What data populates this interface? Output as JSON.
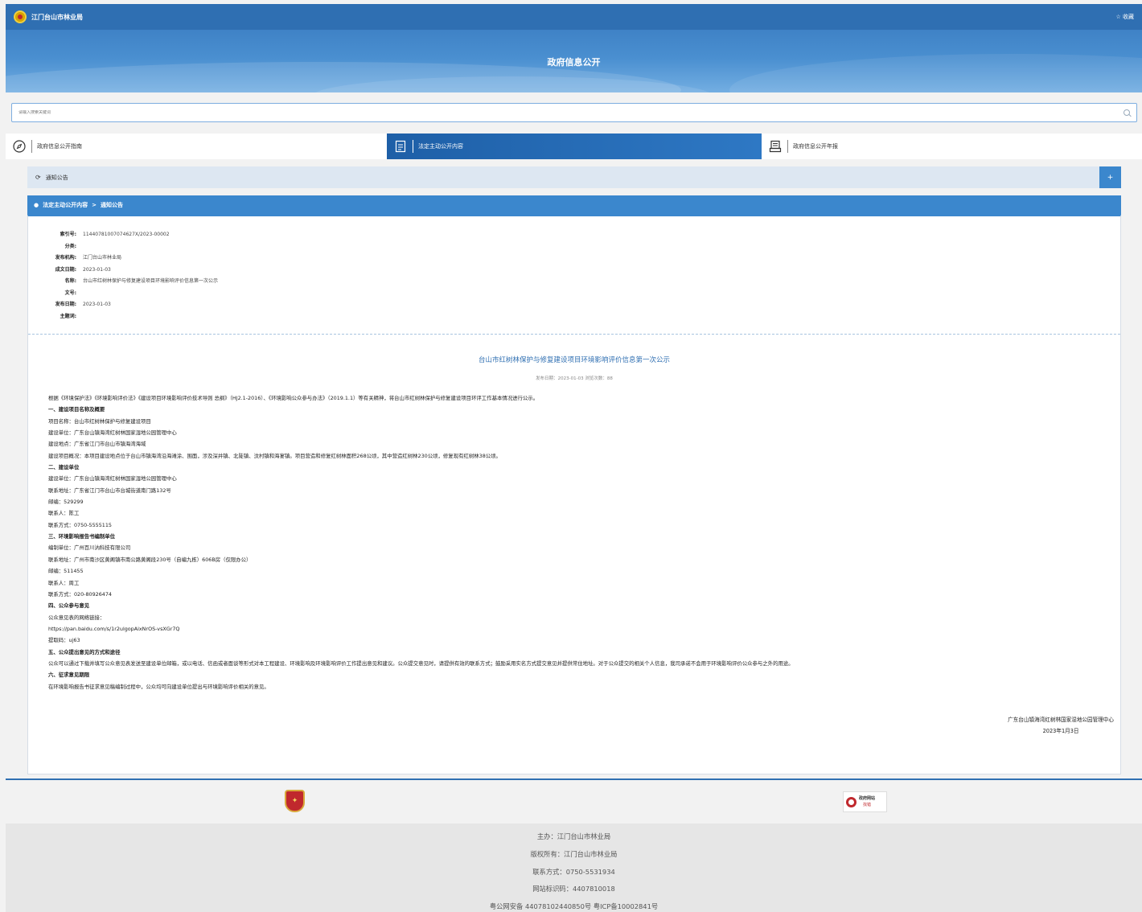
{
  "topbar": {
    "site_name": "江门台山市林业局",
    "favorite": "☆ 收藏"
  },
  "banner": {
    "title": "政府信息公开"
  },
  "search": {
    "placeholder": "请输入搜索关键词"
  },
  "tabs": [
    {
      "label": "政府信息公开指南",
      "icon": "compass-icon"
    },
    {
      "label": "法定主动公开内容",
      "icon": "document-icon",
      "active": true
    },
    {
      "label": "政府信息公开年报",
      "icon": "report-icon"
    }
  ],
  "notice": {
    "label": "通知公告",
    "expand": "+"
  },
  "breadcrumb": {
    "root": "法定主动公开内容",
    "separator": ">",
    "current": "通知公告"
  },
  "meta": [
    {
      "label": "索引号:",
      "value": "11440781007074627X/2023-00002"
    },
    {
      "label": "分类:",
      "value": ""
    },
    {
      "label": "发布机构:",
      "value": "江门台山市林业局"
    },
    {
      "label": "成文日期:",
      "value": "2023-01-03"
    },
    {
      "label": "名称:",
      "value": "台山市红树林保护与修复建设项目环境影响评价信息第一次公示"
    },
    {
      "label": "文号:",
      "value": ""
    },
    {
      "label": "发布日期:",
      "value": "2023-01-03"
    },
    {
      "label": "主题词:",
      "value": ""
    }
  ],
  "article": {
    "title": "台山市红树林保护与修复建设项目环境影响评价信息第一次公示",
    "subtitle": "发布日期：2023-01-03  浏览次数：88",
    "paragraphs": [
      {
        "text": "根据《环境保护法》《环境影响评价法》《建设项目环境影响评价技术导则 总纲》（HJ2.1-2016）、《环境影响公众参与办法》（2019.1.1）等有关精神，将台山市红树林保护与修复建设项目环评工作基本情况进行公示。",
        "heading": false
      },
      {
        "text": "一、建设项目名称及概要",
        "heading": true
      },
      {
        "text": "项目名称：台山市红树林保护与修复建设项目",
        "heading": false
      },
      {
        "text": "建设单位：广东台山镇海湾红树林国家湿地公园管理中心",
        "heading": false
      },
      {
        "text": "建设地点：广东省江门市台山市镇海湾海域",
        "heading": false
      },
      {
        "text": "建设项目概况：本项目建设地点位于台山市镇海湾沿海滩涂、围面，涉及深井镇、北陡镇、汶村镇和海宴镇。项目营造和修复红树林面积268公顷，其中营造红树林230公顷，修复现有红树林38公顷。",
        "heading": false
      },
      {
        "text": "二、建设单位",
        "heading": true
      },
      {
        "text": "建设单位：广东台山镇海湾红树林国家湿地公园管理中心",
        "heading": false
      },
      {
        "text": "联系地址：广东省江门市台山市台城街道南门路132号",
        "heading": false
      },
      {
        "text": "邮编：529299",
        "heading": false
      },
      {
        "text": "联系人：陈工",
        "heading": false
      },
      {
        "text": "联系方式：0750-5555115",
        "heading": false
      },
      {
        "text": "三、环境影响报告书编制单位",
        "heading": true
      },
      {
        "text": "编制单位：广州百川汭科技有限公司",
        "heading": false
      },
      {
        "text": "联系地址：广州市南沙区黄阁镇市南公路黄阁段230号（自编九栋）606B房（仅限办公）",
        "heading": false
      },
      {
        "text": "邮编：511455",
        "heading": false
      },
      {
        "text": "联系人：周工",
        "heading": false
      },
      {
        "text": "联系方式：020-80926474",
        "heading": false
      },
      {
        "text": "四、公众参与意见",
        "heading": true
      },
      {
        "text": "公众意见表的网络链接：",
        "heading": false
      },
      {
        "text": "https://pan.baidu.com/s/1r2ulgopAixNrOS-vsXGr7Q",
        "heading": false
      },
      {
        "text": "提取码：uj63",
        "heading": false
      },
      {
        "text": "五、公众提出意见的方式和途径",
        "heading": true
      },
      {
        "text": "公众可以通过下载并填写公众意见表发送至建设单位邮箱，或以电话、信函或者面谈等形式对本工程建设、环境影响及环境影响评价工作提出意见和建议。公众提交意见时，请提供有效的联系方式；鼓励采用实名方式提交意见并提供常住地址。对于公众提交的相关个人信息，我司承诺不会用于环境影响评价公众参与之外的用途。",
        "heading": false
      },
      {
        "text": "六、征求意见期限",
        "heading": true
      },
      {
        "text": "在环境影响报告书征求意见稿编制过程中，公众均可向建设单位提出与环境影响评价相关的意见。",
        "heading": false
      }
    ],
    "signature": {
      "org": "广东台山镇海湾红树林国家湿地公园管理中心",
      "date": "2023年1月3日"
    }
  },
  "footer": {
    "error_badge": {
      "line1": "政府网站",
      "line2": "找错"
    },
    "lines": [
      "主办：江门台山市林业局",
      "版权所有：江门台山市林业局",
      "联系方式：0750-5531934",
      "网站标识码：4407810018",
      "粤公网安备 44078102440850号 粤ICP备10002841号"
    ]
  },
  "colors": {
    "primary": "#2f6fb2",
    "accent": "#3b87cd",
    "link": "#2f6fb2"
  }
}
